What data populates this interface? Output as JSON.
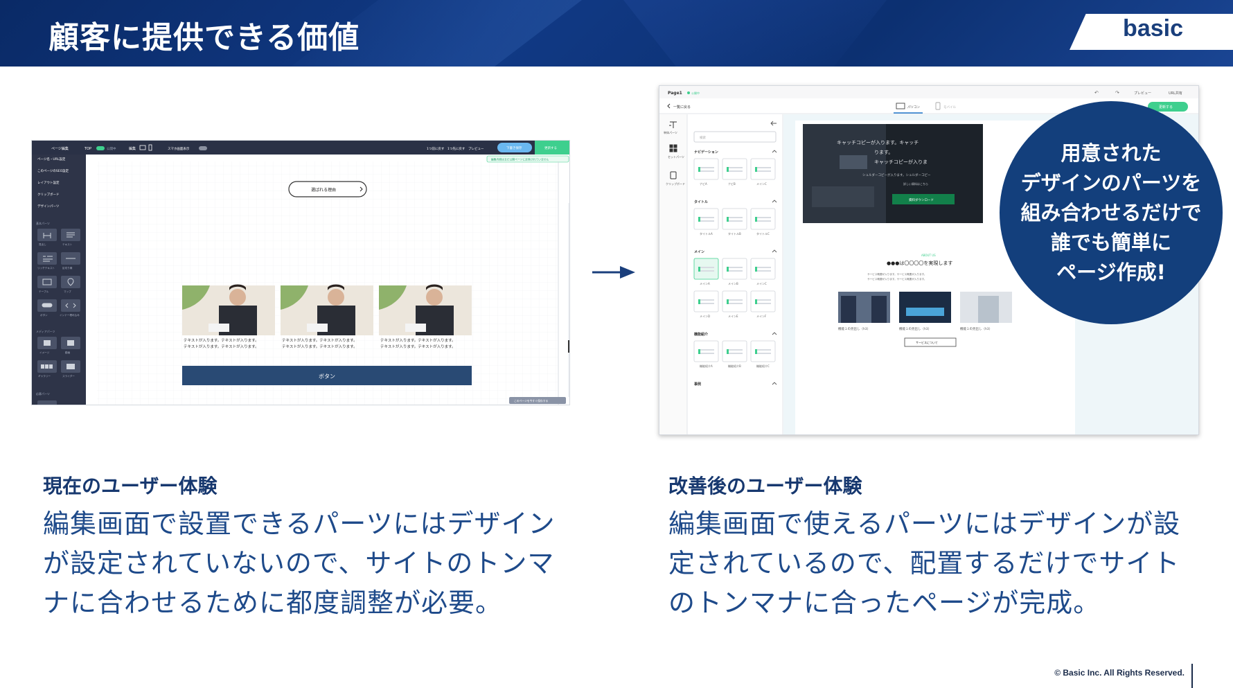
{
  "header": {
    "title": "顧客に提供できる価値",
    "logo": "basic"
  },
  "left_card": {
    "heading": "現在のユーザー体験",
    "lines": [
      "編集画面で設置できるパーツにはデザイン",
      "が設定されていないので、サイトのトンマ",
      "ナに合わせるために都度調整が必要。"
    ]
  },
  "right_card": {
    "heading": "改善後のユーザー体験",
    "lines": [
      "編集画面で使えるパーツにはデザインが設",
      "定されているので、配置するだけでサイト",
      "のトンマナに合ったページが完成。"
    ]
  },
  "badge": {
    "lines": [
      "用意された",
      "デザインのパーツを",
      "組み合わせるだけで",
      "誰でも簡単に",
      "ページ作成!"
    ]
  },
  "footer": {
    "copyright": "© Basic Inc. All Rights Reserved."
  },
  "old_editor": {
    "topbar": {
      "page_edit": "ページ編集",
      "top": "TOP",
      "public": "公開中",
      "edit": "編集",
      "sp_display": "スマホ画面表示",
      "undo": "1つ前に戻す",
      "redo": "1つ先に戻す",
      "preview": "プレビュー",
      "save_draft": "下書き保存",
      "update": "更新する"
    },
    "notice": "編集内容はまだ公開ページに反映されていません",
    "side_items": [
      "ページ名・URL設定",
      "このページのSEO設定",
      "レイアウト設定",
      "クリップボード",
      "デザインパーツ"
    ],
    "basic_parts_label": "基本パーツ",
    "basic_parts": [
      "見出し",
      "テキスト",
      "リッチテキスト",
      "区切り線",
      "テーブル",
      "マップ",
      "ボタン",
      "インナー埋め込み"
    ],
    "media_parts_label": "メディアパーツ",
    "media_parts": [
      "イメージ",
      "動画",
      "ギャラリー",
      "スライダー"
    ],
    "form_parts_label": "応募パーツ",
    "canvas": {
      "pill_button": "選ばれる理由",
      "card_text": [
        "テキストが入ります。テキストが入ります。",
        "テキストが入ります。テキストが入ります。"
      ],
      "cta_button": "ボタン",
      "bottom_tag": "このページを今すぐ保存する"
    }
  },
  "new_editor": {
    "topbar": {
      "page": "Page1",
      "status": "公開中",
      "preview": "プレビュー",
      "url": "URL共有"
    },
    "back": "一覧に戻る",
    "device_pc": "パソコン",
    "device_mobile": "モバイル",
    "save": "更新する",
    "rail": [
      "単体パーツ",
      "セットパーツ",
      "クリップボード"
    ],
    "search_placeholder": "検索",
    "sections": [
      {
        "title": "ナビゲーション",
        "items": [
          "ナビA",
          "ナビB",
          "メインC"
        ]
      },
      {
        "title": "タイトル",
        "items": [
          "タイトルA",
          "タイトルB",
          "タイトルC"
        ]
      },
      {
        "title": "メイン",
        "items": [
          "メインA",
          "メインB",
          "メインC",
          "メインD",
          "メインE",
          "メインF"
        ]
      },
      {
        "title": "機能紹介",
        "items": [
          "機能紹介A",
          "機能紹介B",
          "機能紹介C"
        ]
      },
      {
        "title": "事例",
        "items": []
      }
    ],
    "hero": {
      "copy": [
        "キャッチコピーが入ります。キャッチ",
        "ります。",
        "キャッチコピーが入りま"
      ],
      "sub": "シュルダーコピーが入ります。シュルダーコピー",
      "small": "詳しい資料はこちら",
      "button": "資料ダウンロード"
    },
    "about": {
      "label": "ABOUT US",
      "heading": "●●●は〇〇〇〇を実現します",
      "text": [
        "サービス概要が入ります。サービス概要が入ります。",
        "サービス概要が入ります。サービス概要が入ります。"
      ]
    },
    "features": [
      "機能１の見出し（h3）",
      "機能１の見出し（h3）",
      "機能１の見出し（h3）"
    ],
    "more_button": "サービスについて"
  }
}
